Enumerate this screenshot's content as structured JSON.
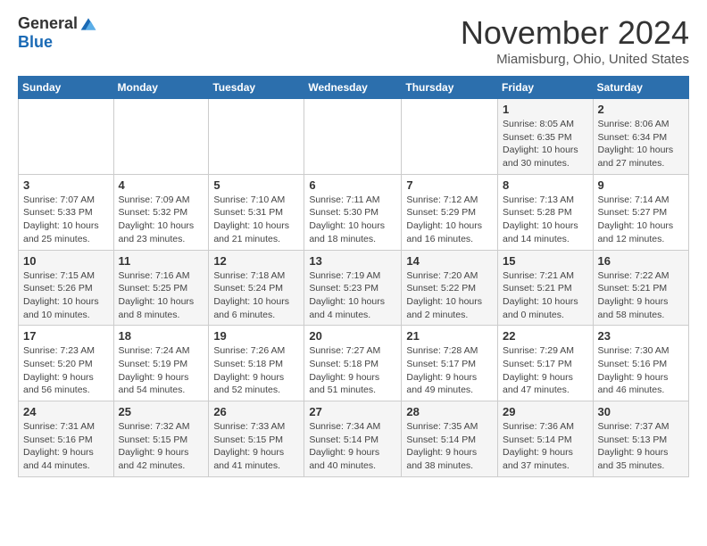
{
  "header": {
    "logo_general": "General",
    "logo_blue": "Blue",
    "month_title": "November 2024",
    "location": "Miamisburg, Ohio, United States"
  },
  "weekdays": [
    "Sunday",
    "Monday",
    "Tuesday",
    "Wednesday",
    "Thursday",
    "Friday",
    "Saturday"
  ],
  "weeks": [
    [
      {
        "day": "",
        "detail": ""
      },
      {
        "day": "",
        "detail": ""
      },
      {
        "day": "",
        "detail": ""
      },
      {
        "day": "",
        "detail": ""
      },
      {
        "day": "",
        "detail": ""
      },
      {
        "day": "1",
        "detail": "Sunrise: 8:05 AM\nSunset: 6:35 PM\nDaylight: 10 hours\nand 30 minutes."
      },
      {
        "day": "2",
        "detail": "Sunrise: 8:06 AM\nSunset: 6:34 PM\nDaylight: 10 hours\nand 27 minutes."
      }
    ],
    [
      {
        "day": "3",
        "detail": "Sunrise: 7:07 AM\nSunset: 5:33 PM\nDaylight: 10 hours\nand 25 minutes."
      },
      {
        "day": "4",
        "detail": "Sunrise: 7:09 AM\nSunset: 5:32 PM\nDaylight: 10 hours\nand 23 minutes."
      },
      {
        "day": "5",
        "detail": "Sunrise: 7:10 AM\nSunset: 5:31 PM\nDaylight: 10 hours\nand 21 minutes."
      },
      {
        "day": "6",
        "detail": "Sunrise: 7:11 AM\nSunset: 5:30 PM\nDaylight: 10 hours\nand 18 minutes."
      },
      {
        "day": "7",
        "detail": "Sunrise: 7:12 AM\nSunset: 5:29 PM\nDaylight: 10 hours\nand 16 minutes."
      },
      {
        "day": "8",
        "detail": "Sunrise: 7:13 AM\nSunset: 5:28 PM\nDaylight: 10 hours\nand 14 minutes."
      },
      {
        "day": "9",
        "detail": "Sunrise: 7:14 AM\nSunset: 5:27 PM\nDaylight: 10 hours\nand 12 minutes."
      }
    ],
    [
      {
        "day": "10",
        "detail": "Sunrise: 7:15 AM\nSunset: 5:26 PM\nDaylight: 10 hours\nand 10 minutes."
      },
      {
        "day": "11",
        "detail": "Sunrise: 7:16 AM\nSunset: 5:25 PM\nDaylight: 10 hours\nand 8 minutes."
      },
      {
        "day": "12",
        "detail": "Sunrise: 7:18 AM\nSunset: 5:24 PM\nDaylight: 10 hours\nand 6 minutes."
      },
      {
        "day": "13",
        "detail": "Sunrise: 7:19 AM\nSunset: 5:23 PM\nDaylight: 10 hours\nand 4 minutes."
      },
      {
        "day": "14",
        "detail": "Sunrise: 7:20 AM\nSunset: 5:22 PM\nDaylight: 10 hours\nand 2 minutes."
      },
      {
        "day": "15",
        "detail": "Sunrise: 7:21 AM\nSunset: 5:21 PM\nDaylight: 10 hours\nand 0 minutes."
      },
      {
        "day": "16",
        "detail": "Sunrise: 7:22 AM\nSunset: 5:21 PM\nDaylight: 9 hours\nand 58 minutes."
      }
    ],
    [
      {
        "day": "17",
        "detail": "Sunrise: 7:23 AM\nSunset: 5:20 PM\nDaylight: 9 hours\nand 56 minutes."
      },
      {
        "day": "18",
        "detail": "Sunrise: 7:24 AM\nSunset: 5:19 PM\nDaylight: 9 hours\nand 54 minutes."
      },
      {
        "day": "19",
        "detail": "Sunrise: 7:26 AM\nSunset: 5:18 PM\nDaylight: 9 hours\nand 52 minutes."
      },
      {
        "day": "20",
        "detail": "Sunrise: 7:27 AM\nSunset: 5:18 PM\nDaylight: 9 hours\nand 51 minutes."
      },
      {
        "day": "21",
        "detail": "Sunrise: 7:28 AM\nSunset: 5:17 PM\nDaylight: 9 hours\nand 49 minutes."
      },
      {
        "day": "22",
        "detail": "Sunrise: 7:29 AM\nSunset: 5:17 PM\nDaylight: 9 hours\nand 47 minutes."
      },
      {
        "day": "23",
        "detail": "Sunrise: 7:30 AM\nSunset: 5:16 PM\nDaylight: 9 hours\nand 46 minutes."
      }
    ],
    [
      {
        "day": "24",
        "detail": "Sunrise: 7:31 AM\nSunset: 5:16 PM\nDaylight: 9 hours\nand 44 minutes."
      },
      {
        "day": "25",
        "detail": "Sunrise: 7:32 AM\nSunset: 5:15 PM\nDaylight: 9 hours\nand 42 minutes."
      },
      {
        "day": "26",
        "detail": "Sunrise: 7:33 AM\nSunset: 5:15 PM\nDaylight: 9 hours\nand 41 minutes."
      },
      {
        "day": "27",
        "detail": "Sunrise: 7:34 AM\nSunset: 5:14 PM\nDaylight: 9 hours\nand 40 minutes."
      },
      {
        "day": "28",
        "detail": "Sunrise: 7:35 AM\nSunset: 5:14 PM\nDaylight: 9 hours\nand 38 minutes."
      },
      {
        "day": "29",
        "detail": "Sunrise: 7:36 AM\nSunset: 5:14 PM\nDaylight: 9 hours\nand 37 minutes."
      },
      {
        "day": "30",
        "detail": "Sunrise: 7:37 AM\nSunset: 5:13 PM\nDaylight: 9 hours\nand 35 minutes."
      }
    ]
  ]
}
